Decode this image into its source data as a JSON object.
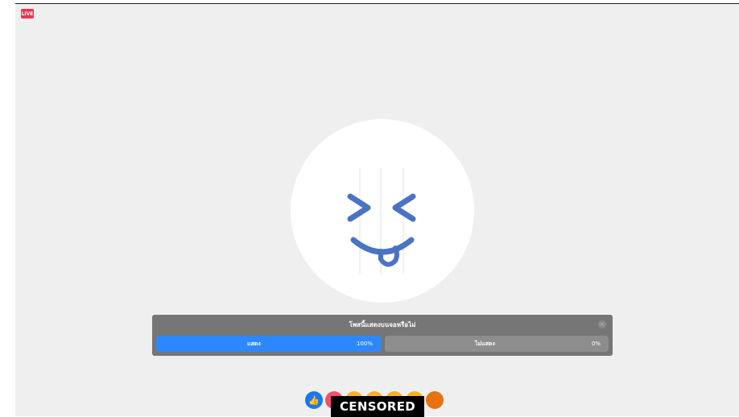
{
  "badge": {
    "label": "LIVE"
  },
  "emoji": {
    "icon": "winking-tongue-face-icon",
    "stroke_color": "#4a73c4"
  },
  "poll": {
    "question": "โพสนี้แสดงบนจอหรือไม่",
    "close_glyph": "×",
    "options": [
      {
        "label": "แสดง",
        "percent_text": "100%",
        "percent": 100,
        "color": "#2d88ff"
      },
      {
        "label": "ไม่แสดง",
        "percent_text": "0%",
        "percent": 0,
        "color": "#8d8d8d"
      }
    ]
  },
  "reactions": [
    {
      "name": "like-icon",
      "glyph": "👍"
    },
    {
      "name": "love-icon",
      "glyph": "❤"
    },
    {
      "name": "haha-icon",
      "glyph": ""
    },
    {
      "name": "wow-icon",
      "glyph": ""
    },
    {
      "name": "sad-icon",
      "glyph": ""
    },
    {
      "name": "care-icon",
      "glyph": ""
    },
    {
      "name": "angry-icon",
      "glyph": ""
    }
  ],
  "censor": {
    "label": "CENSORED"
  }
}
